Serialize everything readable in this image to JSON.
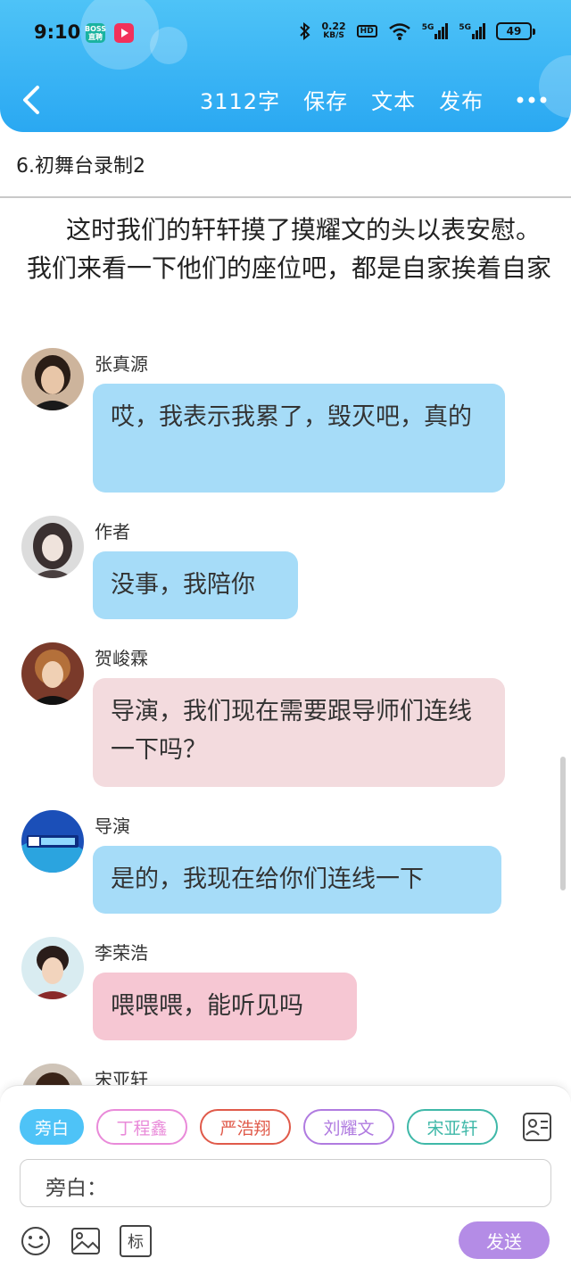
{
  "status_bar": {
    "time": "9:10",
    "app_badges": [
      "BOSS 直聘",
      "video-app"
    ],
    "network_speed": "0.22",
    "network_unit": "KB/S",
    "hd_label": "HD",
    "sim1_label": "5G",
    "sim2_label": "5G",
    "battery": "49"
  },
  "nav": {
    "word_count": "3112字",
    "save_label": "保存",
    "text_label": "文本",
    "publish_label": "发布"
  },
  "chapter": {
    "title": "6.初舞台录制2"
  },
  "narration": "这时我们的轩轩摸了摸耀文的头以表安慰。我们来看一下他们的座位吧，都是自家挨着自家",
  "messages": [
    {
      "speaker": "张真源",
      "text": "哎，我表示我累了，毁灭吧，真的",
      "bubble_color": "#a6dcf8"
    },
    {
      "speaker": "作者",
      "text": "没事，我陪你",
      "bubble_color": "#a6dcf8"
    },
    {
      "speaker": "贺峻霖",
      "text": "导演，我们现在需要跟导师们连线一下吗？",
      "bubble_color": "#f3dbde"
    },
    {
      "speaker": "导演",
      "text": "是的，我现在给你们连线一下",
      "bubble_color": "#a6dcf8"
    },
    {
      "speaker": "李荣浩",
      "text": "喂喂喂，能听见吗",
      "bubble_color": "#f6c7d3"
    },
    {
      "speaker": "宋亚轩",
      "text": "",
      "bubble_color": ""
    }
  ],
  "composer": {
    "roles": [
      {
        "label": "旁白",
        "color": "#4ec3f7",
        "selected": true
      },
      {
        "label": "丁程鑫",
        "color": "#e98ad9",
        "selected": false
      },
      {
        "label": "严浩翔",
        "color": "#e05a4a",
        "selected": false
      },
      {
        "label": "刘耀文",
        "color": "#b07be0",
        "selected": false
      },
      {
        "label": "宋亚轩",
        "color": "#3fb8a8",
        "selected": false
      }
    ],
    "input_value": "旁白：",
    "send_label": "发送",
    "mark_label": "标"
  },
  "colors": {
    "header": "#2aa8f2",
    "send_button": "#b48ce6"
  }
}
